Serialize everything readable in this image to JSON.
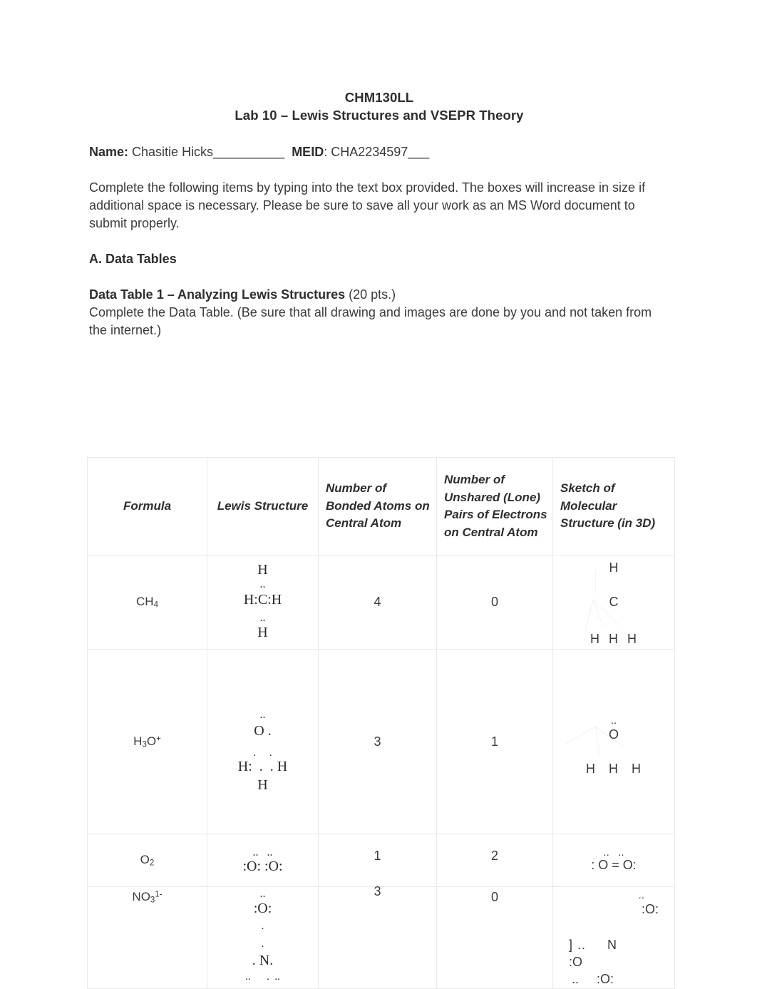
{
  "document": {
    "course_code": "CHM130LL",
    "lab_title": "Lab 10 – Lewis Structures and VSEPR Theory",
    "name_label": "Name:",
    "name_value": " Chasitie Hicks__________",
    "meid_label": "MEID",
    "meid_value": ": CHA2234597___",
    "intro_paragraph": "Complete the following items by typing into the text box provided. The boxes will increase in size if additional space is necessary. Please be sure to save all your work as an MS Word document to submit properly.",
    "section_a_heading": "A. Data Tables",
    "data_table_title": "Data Table 1 – Analyzing Lewis Structures",
    "data_table_points": " (20 pts.)",
    "data_table_instructions": "Complete the Data Table. (Be sure that all drawing and images are done by you and not taken from the internet.)"
  },
  "table": {
    "headers": [
      "Formula",
      "Lewis Structure",
      "Number of Bonded Atoms on Central Atom",
      "Number of Unshared (Lone) Pairs of Electrons on Central Atom",
      "Sketch of Molecular Structure (in 3D)"
    ],
    "rows": [
      {
        "formula_base": "CH",
        "formula_sub": "4",
        "formula_sup": "",
        "lewis_lines": [
          "H",
          "..",
          "H:C:H",
          "..",
          "H"
        ],
        "bonded_atoms": "4",
        "lone_pairs": "0",
        "sketch_lines": [
          "H",
          "C",
          "H  H  H"
        ]
      },
      {
        "formula_base": "H",
        "formula_sub": "3",
        "formula_base2": "O",
        "formula_sup": "+",
        "lewis_lines": [
          "..",
          "O .",
          ".     .",
          "H:  .  . H",
          "H"
        ],
        "bonded_atoms": "3",
        "lone_pairs": "1",
        "sketch_lines": [
          "..",
          "O",
          "H   H   H"
        ]
      },
      {
        "formula_base": "O",
        "formula_sub": "2",
        "formula_sup": "",
        "lewis_lines": [
          "..   ..",
          ":O: :O:"
        ],
        "bonded_atoms": "1",
        "lone_pairs": "2",
        "sketch_lines": [
          "..   ..",
          ": O = O:"
        ]
      },
      {
        "formula_base": "NO",
        "formula_sub": "3",
        "formula_sup": "1-",
        "lewis_lines": [
          "..",
          ":O:",
          ".",
          ".",
          ". N.",
          "..      .  .."
        ],
        "bonded_atoms": "3",
        "lone_pairs": "0",
        "sketch_lines": [
          "..",
          ":O:",
          "] ..     N",
          ":O",
          "..     :O:"
        ]
      }
    ]
  },
  "colors": {
    "text": "#3b3b3b",
    "heading": "#2e2e2e",
    "border": "#e9e9e9",
    "bond": "#f1f1f1",
    "page_background": "#ffffff"
  }
}
